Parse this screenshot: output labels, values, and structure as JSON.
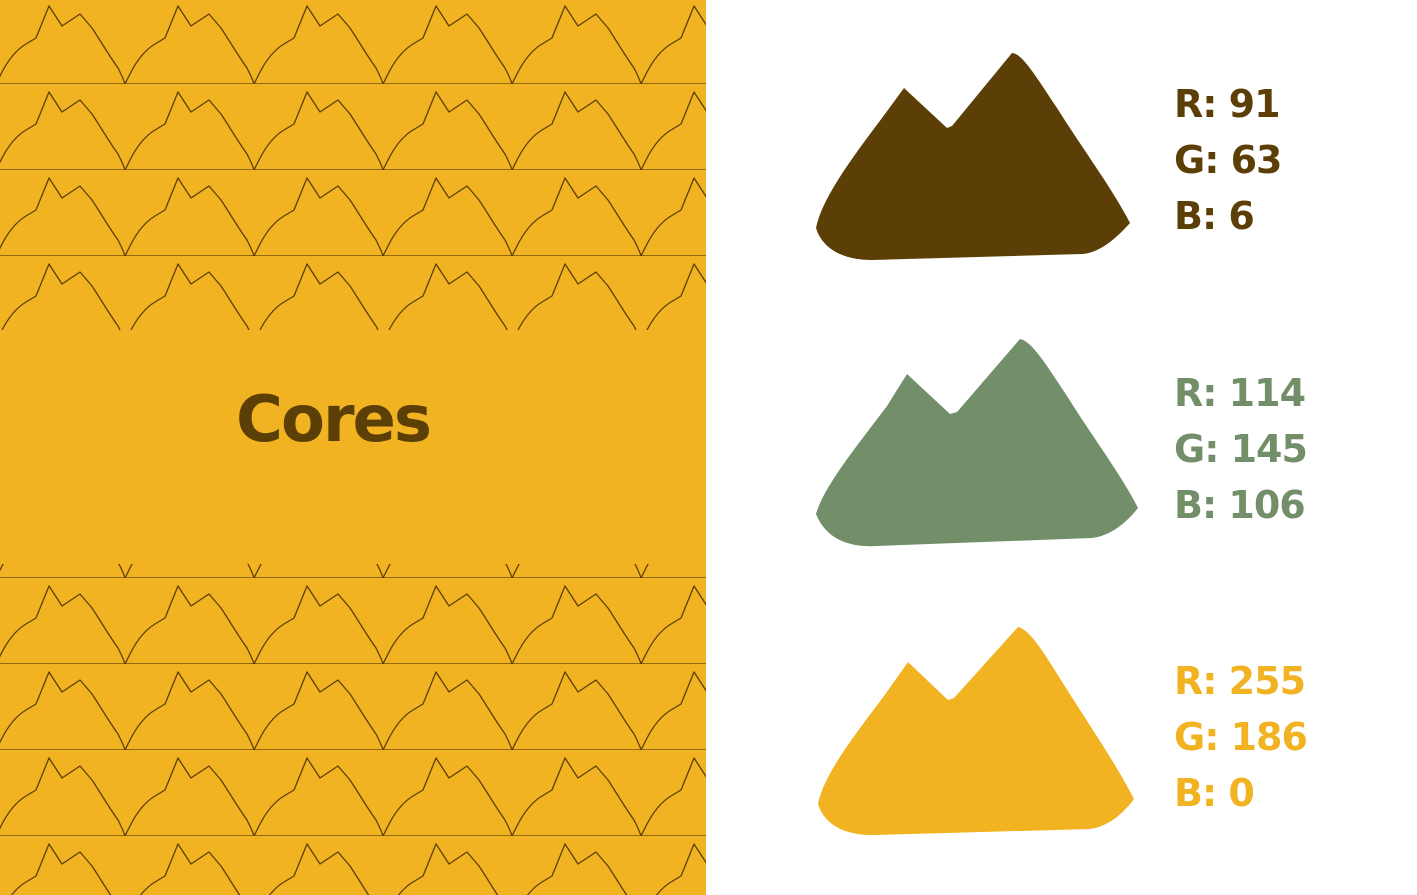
{
  "title": "Cores",
  "colors": {
    "background": "#FFFFFF",
    "panel": "#F2B322",
    "pattern_line": "#5B3F06",
    "title_text": "#5B3F06"
  },
  "swatches": [
    {
      "icon": "mountain-icon",
      "color": "#5B3F06",
      "r": "R: 91",
      "g": "G: 63",
      "b": "B: 6"
    },
    {
      "icon": "mountain-icon",
      "color": "#728F6A",
      "r": "R: 114",
      "g": "G: 145",
      "b": "B: 106"
    },
    {
      "icon": "mountain-icon",
      "color": "#F2B322",
      "r": "R: 255",
      "g": "G: 186",
      "b": "B: 0"
    }
  ]
}
